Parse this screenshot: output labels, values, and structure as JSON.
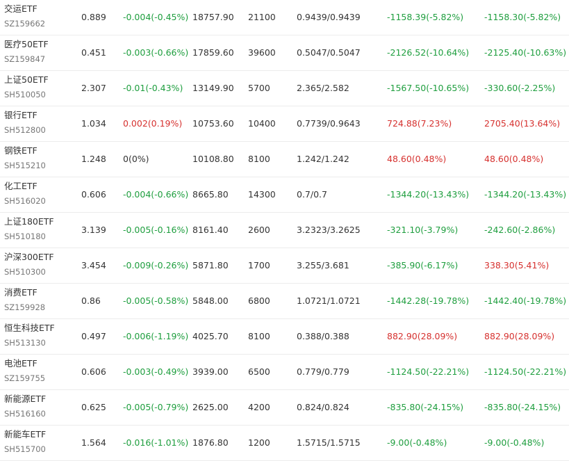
{
  "colors": {
    "up": "#d6312f",
    "down": "#1e9e3e",
    "neutral": "#333333"
  },
  "rows": [
    {
      "name": "交运ETF",
      "code": "SZ159662",
      "price": "0.889",
      "change": "-0.004(-0.45%)",
      "change_dir": "down",
      "market_value": "18757.90",
      "qty": "21100",
      "cost": "0.9439/0.9439",
      "pl1": "-1158.39(-5.82%)",
      "pl1_dir": "down",
      "pl2": "-1158.30(-5.82%)",
      "pl2_dir": "down"
    },
    {
      "name": "医疗50ETF",
      "code": "SZ159847",
      "price": "0.451",
      "change": "-0.003(-0.66%)",
      "change_dir": "down",
      "market_value": "17859.60",
      "qty": "39600",
      "cost": "0.5047/0.5047",
      "pl1": "-2126.52(-10.64%)",
      "pl1_dir": "down",
      "pl2": "-2125.40(-10.63%)",
      "pl2_dir": "down"
    },
    {
      "name": "上证50ETF",
      "code": "SH510050",
      "price": "2.307",
      "change": "-0.01(-0.43%)",
      "change_dir": "down",
      "market_value": "13149.90",
      "qty": "5700",
      "cost": "2.365/2.582",
      "pl1": "-1567.50(-10.65%)",
      "pl1_dir": "down",
      "pl2": "-330.60(-2.25%)",
      "pl2_dir": "down"
    },
    {
      "name": "银行ETF",
      "code": "SH512800",
      "price": "1.034",
      "change": "0.002(0.19%)",
      "change_dir": "up",
      "market_value": "10753.60",
      "qty": "10400",
      "cost": "0.7739/0.9643",
      "pl1": "724.88(7.23%)",
      "pl1_dir": "up",
      "pl2": "2705.40(13.64%)",
      "pl2_dir": "up"
    },
    {
      "name": "钢铁ETF",
      "code": "SH515210",
      "price": "1.248",
      "change": "0(0%)",
      "change_dir": "neutral",
      "market_value": "10108.80",
      "qty": "8100",
      "cost": "1.242/1.242",
      "pl1": "48.60(0.48%)",
      "pl1_dir": "up",
      "pl2": "48.60(0.48%)",
      "pl2_dir": "up"
    },
    {
      "name": "化工ETF",
      "code": "SH516020",
      "price": "0.606",
      "change": "-0.004(-0.66%)",
      "change_dir": "down",
      "market_value": "8665.80",
      "qty": "14300",
      "cost": "0.7/0.7",
      "pl1": "-1344.20(-13.43%)",
      "pl1_dir": "down",
      "pl2": "-1344.20(-13.43%)",
      "pl2_dir": "down"
    },
    {
      "name": "上证180ETF",
      "code": "SH510180",
      "price": "3.139",
      "change": "-0.005(-0.16%)",
      "change_dir": "down",
      "market_value": "8161.40",
      "qty": "2600",
      "cost": "3.2323/3.2625",
      "pl1": "-321.10(-3.79%)",
      "pl1_dir": "down",
      "pl2": "-242.60(-2.86%)",
      "pl2_dir": "down"
    },
    {
      "name": "沪深300ETF",
      "code": "SH510300",
      "price": "3.454",
      "change": "-0.009(-0.26%)",
      "change_dir": "down",
      "market_value": "5871.80",
      "qty": "1700",
      "cost": "3.255/3.681",
      "pl1": "-385.90(-6.17%)",
      "pl1_dir": "down",
      "pl2": "338.30(5.41%)",
      "pl2_dir": "up"
    },
    {
      "name": "消费ETF",
      "code": "SZ159928",
      "price": "0.86",
      "change": "-0.005(-0.58%)",
      "change_dir": "down",
      "market_value": "5848.00",
      "qty": "6800",
      "cost": "1.0721/1.0721",
      "pl1": "-1442.28(-19.78%)",
      "pl1_dir": "down",
      "pl2": "-1442.40(-19.78%)",
      "pl2_dir": "down"
    },
    {
      "name": "恒生科技ETF",
      "code": "SH513130",
      "price": "0.497",
      "change": "-0.006(-1.19%)",
      "change_dir": "down",
      "market_value": "4025.70",
      "qty": "8100",
      "cost": "0.388/0.388",
      "pl1": "882.90(28.09%)",
      "pl1_dir": "up",
      "pl2": "882.90(28.09%)",
      "pl2_dir": "up"
    },
    {
      "name": "电池ETF",
      "code": "SZ159755",
      "price": "0.606",
      "change": "-0.003(-0.49%)",
      "change_dir": "down",
      "market_value": "3939.00",
      "qty": "6500",
      "cost": "0.779/0.779",
      "pl1": "-1124.50(-22.21%)",
      "pl1_dir": "down",
      "pl2": "-1124.50(-22.21%)",
      "pl2_dir": "down"
    },
    {
      "name": "新能源ETF",
      "code": "SH516160",
      "price": "0.625",
      "change": "-0.005(-0.79%)",
      "change_dir": "down",
      "market_value": "2625.00",
      "qty": "4200",
      "cost": "0.824/0.824",
      "pl1": "-835.80(-24.15%)",
      "pl1_dir": "down",
      "pl2": "-835.80(-24.15%)",
      "pl2_dir": "down"
    },
    {
      "name": "新能车ETF",
      "code": "SH515700",
      "price": "1.564",
      "change": "-0.016(-1.01%)",
      "change_dir": "down",
      "market_value": "1876.80",
      "qty": "1200",
      "cost": "1.5715/1.5715",
      "pl1": "-9.00(-0.48%)",
      "pl1_dir": "down",
      "pl2": "-9.00(-0.48%)",
      "pl2_dir": "down"
    }
  ]
}
